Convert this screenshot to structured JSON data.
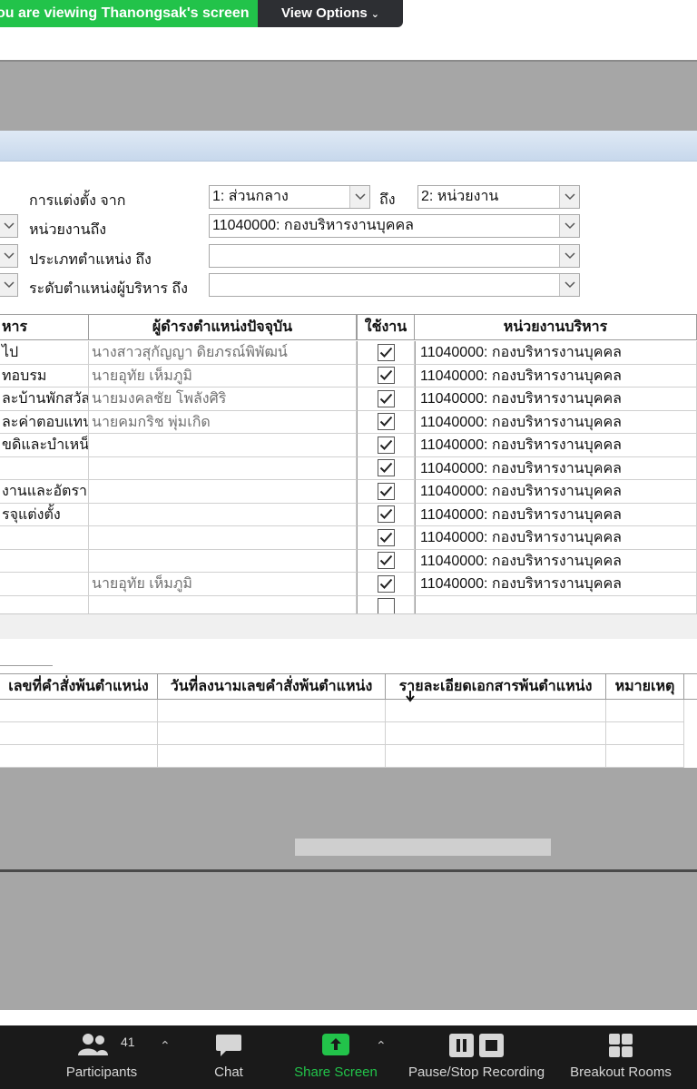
{
  "banner": {
    "viewing_text": "ou are viewing Thanongsak's screen",
    "view_options": "View Options"
  },
  "form": {
    "appoint_from_label": "การแต่งตั้ง จาก",
    "appoint_from_value": "1: ส่วนกลาง",
    "to_label": "ถึง",
    "appoint_to_value": "2: หน่วยงาน",
    "unit_to_label": "หน่วยงานถึง",
    "unit_to_value": "11040000: กองบริหารงานบุคคล",
    "position_type_label": "ประเภทตำแหน่ง ถึง",
    "position_type_value": "",
    "exec_level_label": "ระดับตำแหน่งผู้บริหาร ถึง",
    "exec_level_value": ""
  },
  "main_grid": {
    "headers": [
      "หาร",
      "ผู้ดำรงตำแหน่งปัจจุบัน",
      "ใช้งาน",
      "หน่วยงานบริหาร"
    ],
    "rows": [
      {
        "col1": "ไป",
        "name": "นางสาวสุกัญญา ดิยภรณ์พิพัฒน์",
        "checked": true,
        "unit": "11040000: กองบริหารงานบุคคล"
      },
      {
        "col1": "ทอบรม",
        "name": "นายอุทัย เห็มภูมิ",
        "checked": true,
        "unit": "11040000: กองบริหารงานบุคคล"
      },
      {
        "col1": "ละบ้านพักสวัส",
        "name": "นายมงคลชัย โพลังศิริ",
        "checked": true,
        "unit": "11040000: กองบริหารงานบุคคล"
      },
      {
        "col1": "ละค่าตอบแทน",
        "name": "นายคมกริช พุ่มเกิด",
        "checked": true,
        "unit": "11040000: กองบริหารงานบุคคล"
      },
      {
        "col1": "ขดิและบำเหน็",
        "name": "",
        "checked": true,
        "unit": "11040000: กองบริหารงานบุคคล"
      },
      {
        "col1": "",
        "name": "",
        "checked": true,
        "unit": "11040000: กองบริหารงานบุคคล"
      },
      {
        "col1": "งานและอัตรากำ",
        "name": "",
        "checked": true,
        "unit": "11040000: กองบริหารงานบุคคล"
      },
      {
        "col1": "รจุแต่งตั้ง",
        "name": "",
        "checked": true,
        "unit": "11040000: กองบริหารงานบุคคล"
      },
      {
        "col1": "",
        "name": "",
        "checked": true,
        "unit": "11040000: กองบริหารงานบุคคล"
      },
      {
        "col1": "",
        "name": "",
        "checked": true,
        "unit": "11040000: กองบริหารงานบุคคล"
      },
      {
        "col1": "",
        "name": "นายอุทัย เห็มภูมิ",
        "checked": true,
        "unit": "11040000: กองบริหารงานบุคคล"
      },
      {
        "col1": "",
        "name": "",
        "checked": false,
        "unit": ""
      }
    ]
  },
  "second_grid": {
    "headers": [
      "เลขที่คำสั่งพ้นตำแหน่ง",
      "วันที่ลงนามเลขคำสั่งพ้นตำแหน่ง",
      "รายละเอียดเอกสารพ้นตำแหน่ง",
      "หมายเหตุ"
    ]
  },
  "toolbar": {
    "participants_label": "Participants",
    "participants_count": "41",
    "chat_label": "Chat",
    "share_label": "Share Screen",
    "record_label": "Pause/Stop Recording",
    "breakout_label": "Breakout Rooms",
    "share_color": "#22c34a"
  }
}
